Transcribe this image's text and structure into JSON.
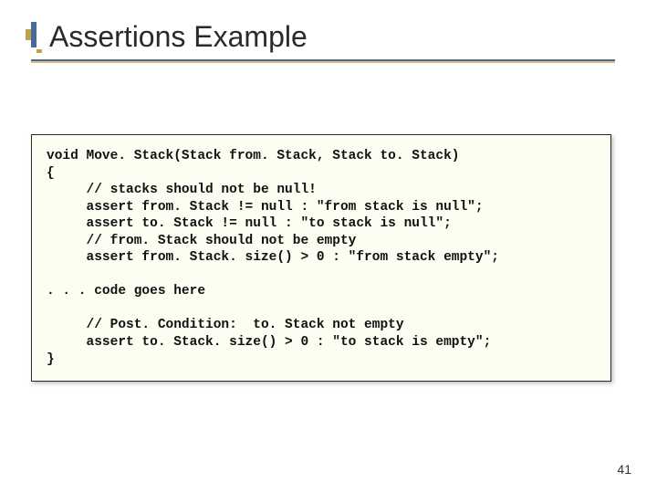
{
  "title": "Assertions Example",
  "code": {
    "l01": "void Move. Stack(Stack from. Stack, Stack to. Stack)",
    "l02": "{",
    "l03": "     // stacks should not be null!",
    "l04": "     assert from. Stack != null : \"from stack is null\";",
    "l05": "     assert to. Stack != null : \"to stack is null\";",
    "l06": "     // from. Stack should not be empty",
    "l07": "     assert from. Stack. size() > 0 : \"from stack empty\";",
    "l08": "",
    "l09": ". . . code goes here",
    "l10": "",
    "l11": "     // Post. Condition:  to. Stack not empty",
    "l12": "     assert to. Stack. size() > 0 : \"to stack is empty\";",
    "l13": "}"
  },
  "page_number": "41"
}
